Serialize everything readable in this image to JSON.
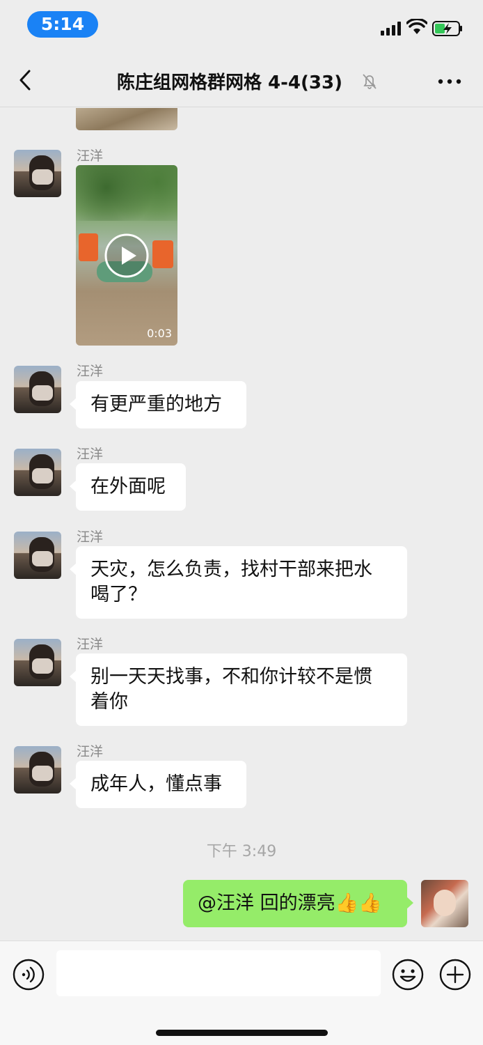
{
  "status_bar": {
    "time": "5:14"
  },
  "nav": {
    "title": "陈庄组网格群网格 4-4(33)",
    "back_icon": "chevron-left-icon",
    "mute_icon": "bell-slash-icon",
    "more_icon": "ellipsis-icon"
  },
  "messages": [
    {
      "type": "video",
      "sender": "汪洋",
      "duration": "0:03"
    },
    {
      "type": "text",
      "sender": "汪洋",
      "text": "有更严重的地方"
    },
    {
      "type": "text",
      "sender": "汪洋",
      "text": "在外面呢"
    },
    {
      "type": "text",
      "sender": "汪洋",
      "line1": "天灾，怎么负责，找村干部来把水",
      "line2": "喝了？"
    },
    {
      "type": "text",
      "sender": "汪洋",
      "line1": "别一天天找事，不和你计较不是惯",
      "line2": "着你"
    },
    {
      "type": "text",
      "sender": "汪洋",
      "text": "成年人，懂点事"
    }
  ],
  "timestamp": "下午 3:49",
  "my_message": {
    "text": "@汪洋 回的漂亮👍👍"
  },
  "colors": {
    "my_bubble": "#95ec69",
    "time_pill": "#1a82f5",
    "background": "#ededed"
  },
  "input_bar": {
    "voice_icon": "voice-icon",
    "emoji_icon": "emoji-icon",
    "plus_icon": "plus-icon"
  }
}
